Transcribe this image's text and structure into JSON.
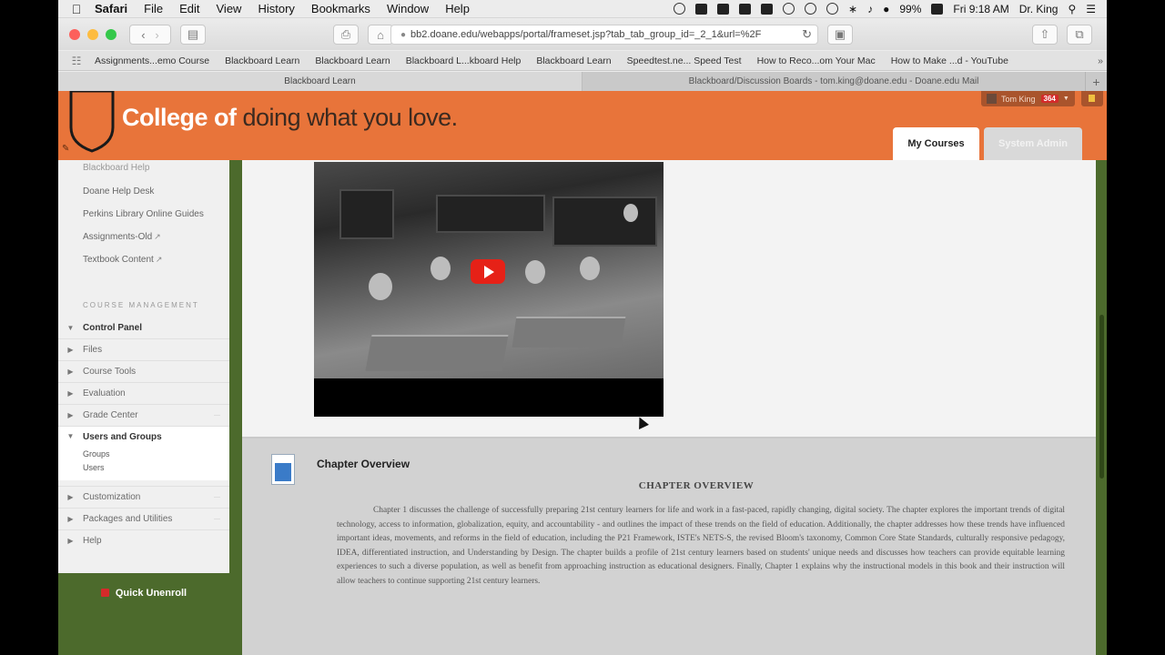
{
  "menubar": {
    "app": "Safari",
    "items": [
      "File",
      "Edit",
      "View",
      "History",
      "Bookmarks",
      "Window",
      "Help"
    ],
    "battery": "99%",
    "time": "Fri 9:18 AM",
    "user": "Dr. King"
  },
  "browser": {
    "url": "bb2.doane.edu/webapps/portal/frameset.jsp?tab_tab_group_id=_2_1&url=%2F",
    "bookmarks": [
      "Assignments...emo Course",
      "Blackboard Learn",
      "Blackboard Learn",
      "Blackboard L...kboard Help",
      "Blackboard Learn",
      "Speedtest.ne... Speed Test",
      "How to Reco...om Your Mac",
      "How to Make ...d - YouTube"
    ],
    "tabs": [
      "Blackboard Learn",
      "Blackboard/Discussion Boards - tom.king@doane.edu - Doane.edu Mail"
    ]
  },
  "header": {
    "brand_bold": "College of",
    "brand_rest": " doing what you love.",
    "user_name": "Tom King",
    "notif_count": "364",
    "tabs": [
      "My Courses",
      "System Admin"
    ]
  },
  "sidebar": {
    "links": [
      "Blackboard Help",
      "Doane Help Desk",
      "Perkins Library Online Guides",
      "Assignments-Old",
      "Textbook Content"
    ],
    "course_mgmt_heading": "COURSE MANAGEMENT",
    "control_panel": "Control Panel",
    "cp_items": [
      "Files",
      "Course Tools",
      "Evaluation",
      "Grade Center",
      "Users and Groups",
      "Customization",
      "Packages and Utilities",
      "Help"
    ],
    "users_groups_sub": [
      "Groups",
      "Users"
    ],
    "quick_unenroll": "Quick Unenroll"
  },
  "chapter": {
    "title": "Chapter Overview",
    "heading": "CHAPTER OVERVIEW",
    "body": "Chapter 1 discusses the challenge of successfully preparing 21st century learners for life and work in a fast-paced, rapidly changing, digital society. The chapter explores the important trends of digital technology, access to information, globalization, equity, and accountability - and outlines the impact of these trends on the field of education. Additionally, the chapter addresses how these trends have influenced important ideas, movements, and reforms in the field of education, including the P21 Framework, ISTE's NETS-S, the revised Bloom's taxonomy, Common Core State Standards, culturally responsive pedagogy, IDEA, differentiated instruction, and Understanding by Design. The chapter builds a profile of 21st century learners based on students' unique needs and discusses how teachers can provide equitable learning experiences to such a diverse population, as well as benefit from approaching instruction as educational designers. Finally, Chapter 1 explains why the instructional models in this book and their instruction will allow teachers to continue supporting 21st century learners."
  }
}
